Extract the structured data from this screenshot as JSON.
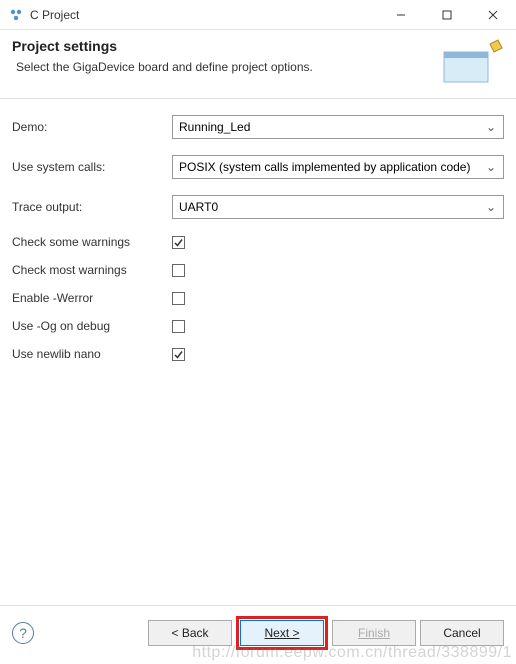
{
  "titlebar": {
    "title": "C Project"
  },
  "header": {
    "title": "Project settings",
    "subtitle": "Select the GigaDevice board and define project options."
  },
  "form": {
    "demo_label": "Demo:",
    "demo_value": "Running_Led",
    "syscalls_label": "Use system calls:",
    "syscalls_value": "POSIX (system calls implemented by application code)",
    "trace_label": "Trace output:",
    "trace_value": "UART0",
    "check_some_label": "Check some warnings",
    "check_some": true,
    "check_most_label": "Check most warnings",
    "check_most": false,
    "werror_label": "Enable -Werror",
    "werror": false,
    "og_label": "Use -Og on debug",
    "og": false,
    "newlib_label": "Use newlib nano",
    "newlib": true
  },
  "footer": {
    "back": "< Back",
    "next": "Next >",
    "finish": "Finish",
    "cancel": "Cancel"
  },
  "watermark": "http://forum.eepw.com.cn/thread/338899/1"
}
